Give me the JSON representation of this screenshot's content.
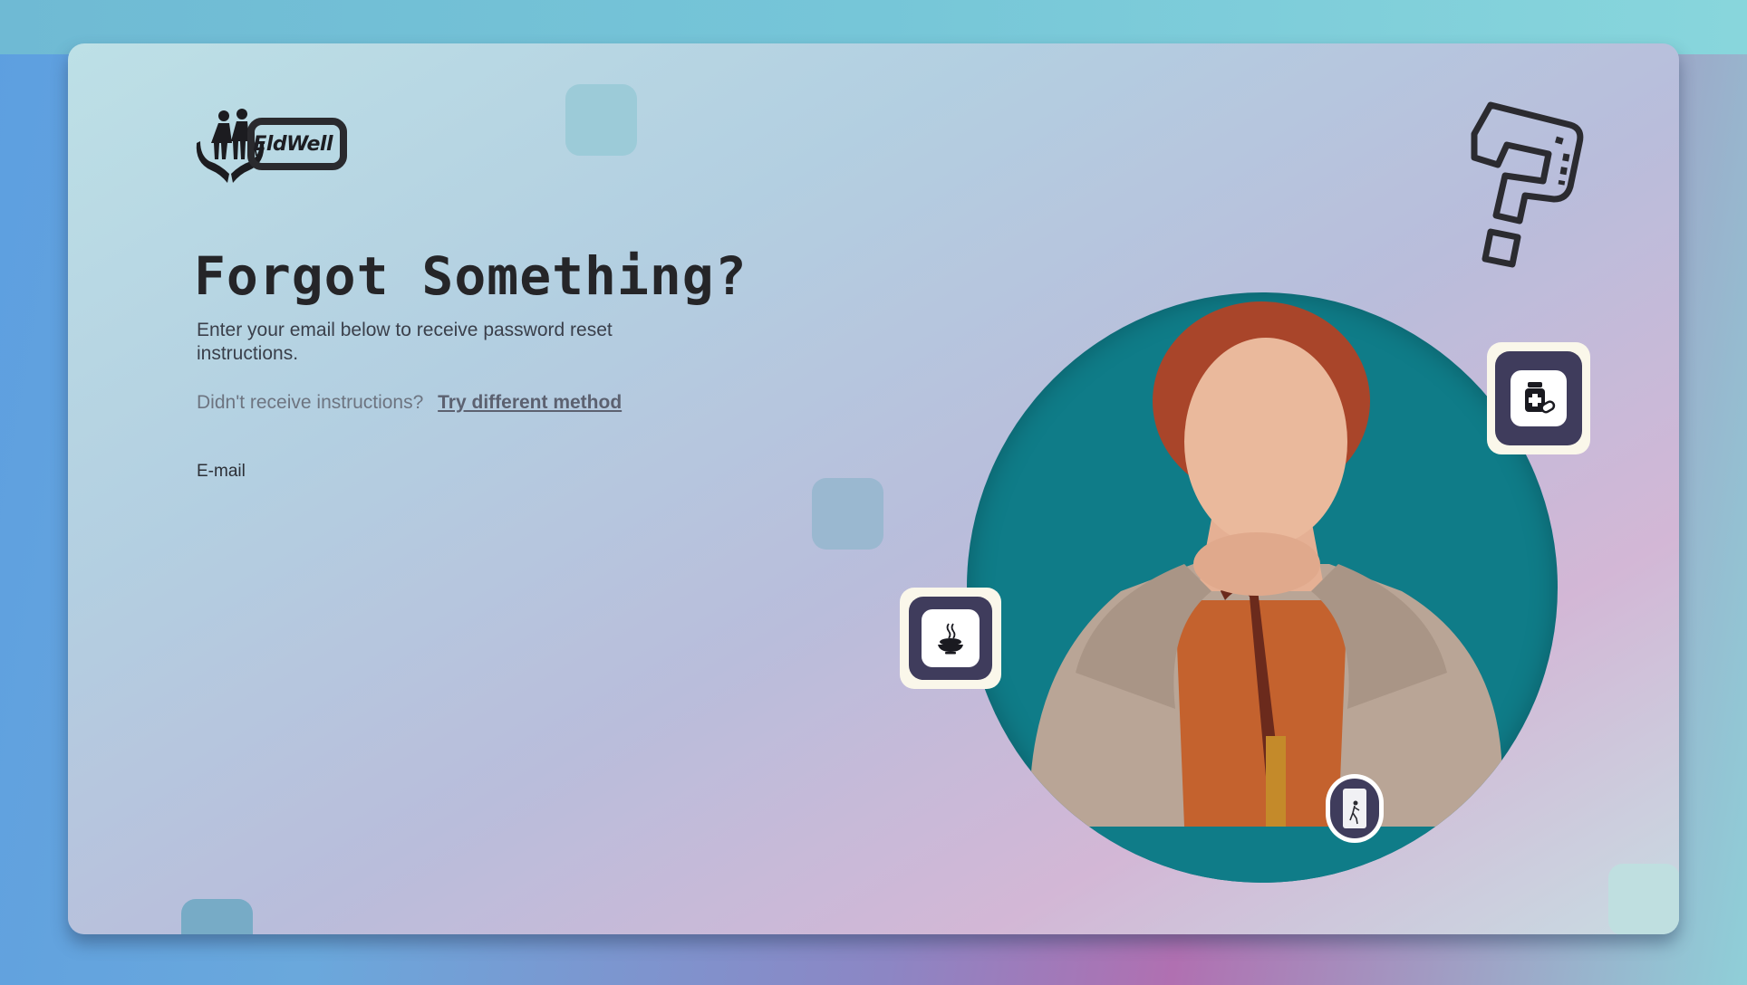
{
  "brand": {
    "name": "EldWell"
  },
  "heading": "Forgot Something?",
  "subtitle": "Enter your email below to receive password reset instructions.",
  "resend": {
    "prompt": "Didn't receive instructions?",
    "link_label": "Try different method"
  },
  "form": {
    "email_label": "E-mail"
  },
  "colors": {
    "circle_bg": "#0f7c88",
    "badge_dark": "#3f3c5c",
    "text_dark": "#252528"
  },
  "icons": {
    "medicine": "medicine-bottle-icon",
    "food": "food-bowl-icon",
    "exit": "door-exit-icon",
    "help": "question-mark-icon"
  }
}
